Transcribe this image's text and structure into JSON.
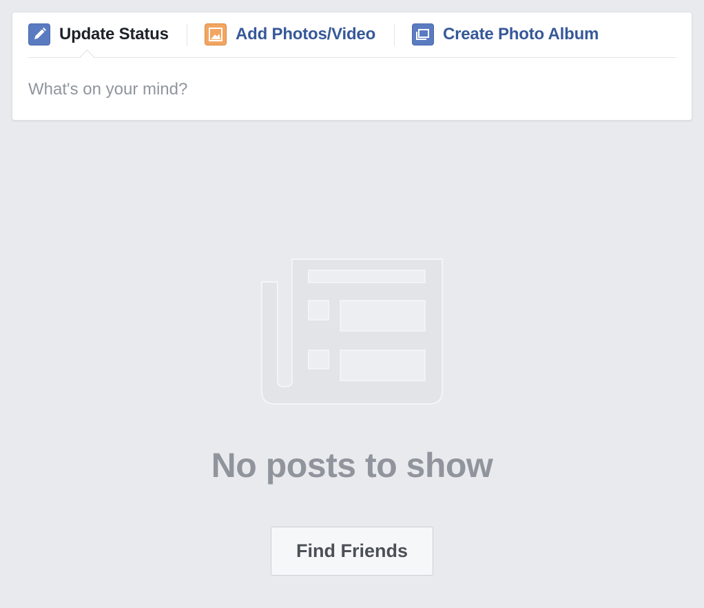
{
  "composer": {
    "tabs": [
      {
        "label": "Update Status",
        "icon": "pencil-icon",
        "active": true
      },
      {
        "label": "Add Photos/Video",
        "icon": "photo-icon",
        "active": false
      },
      {
        "label": "Create Photo Album",
        "icon": "photo-album-icon",
        "active": false
      }
    ],
    "input_placeholder": "What's on your mind?",
    "input_value": ""
  },
  "empty_state": {
    "illustration": "newspaper-icon",
    "title": "No posts to show",
    "button_label": "Find Friends"
  },
  "colors": {
    "background": "#e9eaed",
    "link": "#365899",
    "active_text": "#1d2129",
    "muted_text": "#90949c",
    "status_icon": "#5b7bc0",
    "photo_icon": "#f2a561"
  }
}
